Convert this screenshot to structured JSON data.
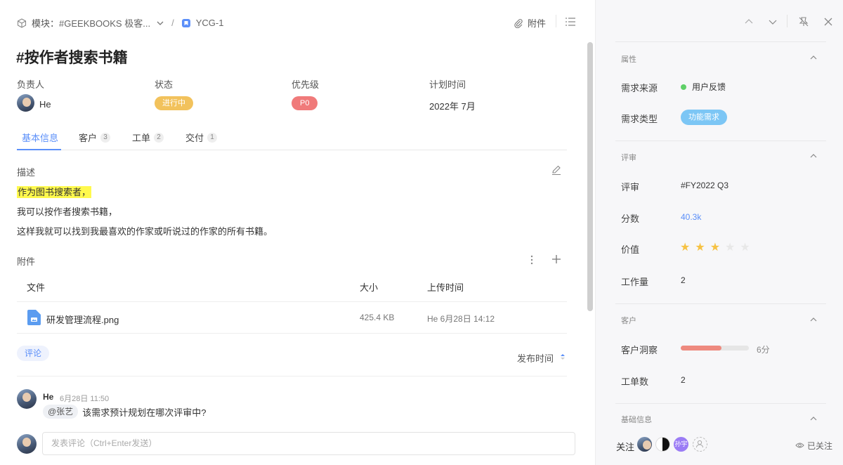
{
  "header": {
    "module_prefix": "模块：",
    "module_name": "#GEEKBOOKS 极客...",
    "separator": "/",
    "issue_id": "YCG-1",
    "attach_label": "附件"
  },
  "title": "#按作者搜索书籍",
  "fields": {
    "assignee_label": "负责人",
    "assignee_name": "He",
    "status_label": "状态",
    "status_value": "进行中",
    "priority_label": "优先级",
    "priority_value": "P0",
    "plan_label": "计划时间",
    "plan_value": "2022年 7月"
  },
  "tabs": [
    {
      "label": "基本信息",
      "count": ""
    },
    {
      "label": "客户",
      "count": "3"
    },
    {
      "label": "工单",
      "count": "2"
    },
    {
      "label": "交付",
      "count": "1"
    }
  ],
  "description": {
    "label": "描述",
    "line1": "作为图书搜索者，",
    "line2": "我可以按作者搜索书籍，",
    "line3": "这样我就可以找到我最喜欢的作家或听说过的作家的所有书籍。"
  },
  "attachments": {
    "label": "附件",
    "col_file": "文件",
    "col_size": "大小",
    "col_time": "上传时间",
    "rows": [
      {
        "name": "研发管理流程.png",
        "size": "425.4 KB",
        "time": "He 6月28日 14:12"
      }
    ]
  },
  "comments": {
    "tab_label": "评论",
    "sort_label": "发布时间",
    "items": [
      {
        "author": "He",
        "time": "6月28日 11:50",
        "mention": "@张艺",
        "text": "该需求预计规划在哪次评审中?"
      }
    ],
    "input_placeholder": "发表评论（Ctrl+Enter发送）"
  },
  "sidebar": {
    "attributes": {
      "title": "属性",
      "source_label": "需求来源",
      "source_value": "用户反馈",
      "source_dot_color": "#5fd068",
      "type_label": "需求类型",
      "type_value": "功能需求"
    },
    "review": {
      "title": "评审",
      "review_label": "评审",
      "review_value": "#FY2022 Q3",
      "score_label": "分数",
      "score_value": "40.3k",
      "value_label": "价值",
      "value_stars": 3,
      "value_max": 5,
      "workload_label": "工作量",
      "workload_value": "2"
    },
    "customers": {
      "title": "客户",
      "insight_label": "客户洞察",
      "insight_score": 6,
      "insight_max": 10,
      "insight_text": "6分",
      "tickets_label": "工单数",
      "tickets_value": "2"
    },
    "basic": {
      "title": "基础信息",
      "follow_label": "关注",
      "follower_badge": "孙宇",
      "followed_label": "已关注"
    }
  },
  "colors": {
    "accent": "#5b8ff9",
    "status": "#f2c25c",
    "priority": "#f07a7a",
    "type_pill": "#7cc6f5",
    "star_on": "#f6c244",
    "star_off": "#e8e8e8",
    "progress": "#ee8a7f"
  }
}
